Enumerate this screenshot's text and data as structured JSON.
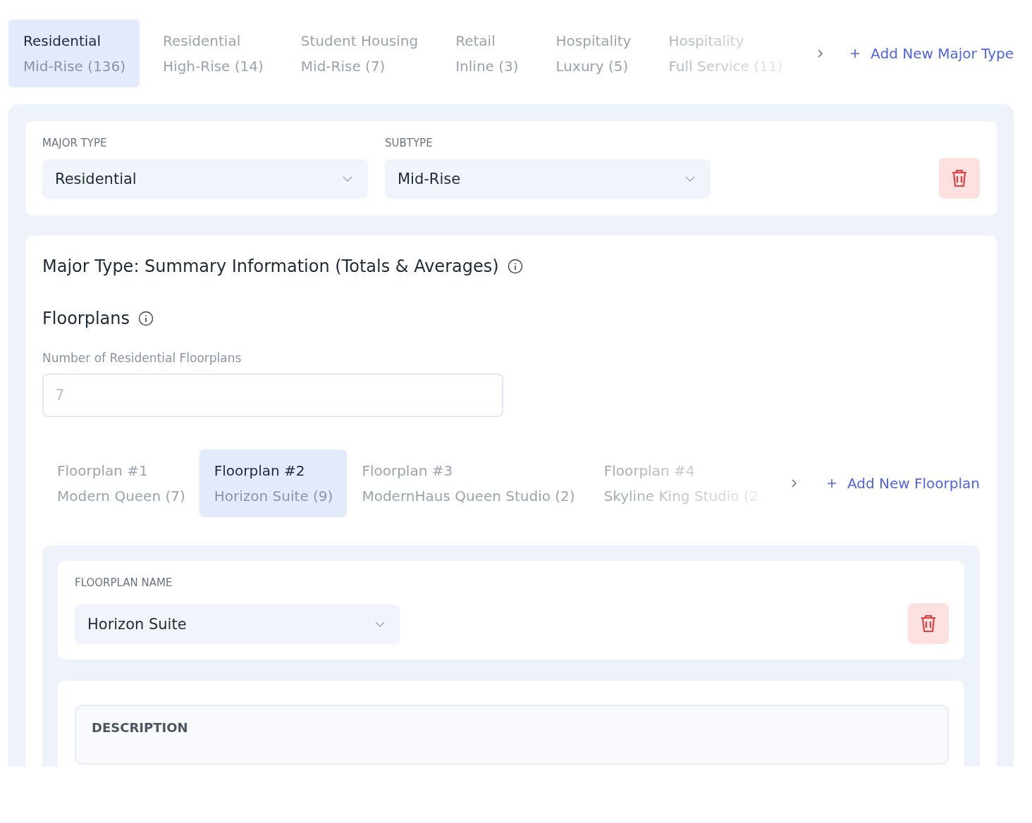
{
  "major_tabs": [
    {
      "title": "Residential",
      "subtitle": "Mid-Rise (136)",
      "selected": true
    },
    {
      "title": "Residential",
      "subtitle": "High-Rise (14)",
      "selected": false
    },
    {
      "title": "Student Housing",
      "subtitle": "Mid-Rise (7)",
      "selected": false
    },
    {
      "title": "Retail",
      "subtitle": "Inline (3)",
      "selected": false
    },
    {
      "title": "Hospitality",
      "subtitle": "Luxury (5)",
      "selected": false
    },
    {
      "title": "Hospitality",
      "subtitle": "Full Service (11)",
      "selected": false
    }
  ],
  "add_major_type": "Add New Major Type",
  "type_card": {
    "major_type": {
      "label": "MAJOR TYPE",
      "value": "Residential"
    },
    "subtype": {
      "label": "SUBTYPE",
      "value": "Mid-Rise"
    }
  },
  "summary_title": "Major Type: Summary Information (Totals & Averages)",
  "floorplans": {
    "title": "Floorplans",
    "count_label": "Number of Residential Floorplans",
    "count_placeholder": "7",
    "tabs": [
      {
        "title": "Floorplan #1",
        "subtitle": "Modern Queen (7)",
        "selected": false
      },
      {
        "title": "Floorplan #2",
        "subtitle": "Horizon Suite (9)",
        "selected": true
      },
      {
        "title": "Floorplan #3",
        "subtitle": "ModernHaus Queen Studio (2)",
        "selected": false
      },
      {
        "title": "Floorplan #4",
        "subtitle": "Skyline King Studio (2",
        "selected": false
      }
    ],
    "add_floorplan": "Add New Floorplan",
    "name_label": "FLOORPLAN NAME",
    "name_value": "Horizon Suite",
    "description_label": "DESCRIPTION"
  }
}
